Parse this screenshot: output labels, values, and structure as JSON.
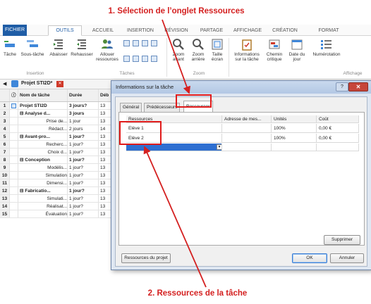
{
  "annotations": {
    "top": "1. Sélection de l’onglet Ressources",
    "bottom": "2. Ressources de la tâche"
  },
  "ribbon": {
    "tabs": [
      "FICHIER",
      "OUTILS GANTT",
      "ACCUEIL",
      "INSERTION",
      "RÉVISION",
      "PARTAGE",
      "AFFICHAGE",
      "CRÉATION",
      "FORMAT"
    ],
    "buttons": {
      "tache": "Tâche",
      "sous_tache": "Sous-tâche",
      "abaisser": "Abaisser",
      "rehausser": "Rehausser",
      "allouer": "Allouer ressources",
      "zoom_avant": "Zoom avant",
      "zoom_arriere": "Zoom arrière",
      "taille_ecran": "Taille écran",
      "informations": "Informations sur la tâche",
      "chemin_critique": "Chemin critique",
      "date_du_jour": "Date du jour",
      "numerotation": "Numérotation"
    },
    "groups": {
      "insertion": "Insertion",
      "taches": "Tâches",
      "zoom": "Zoom",
      "affichage": "Affichage"
    }
  },
  "project_tab": {
    "label": "Projet STI2D*"
  },
  "grid": {
    "headers": {
      "name": "Nom de tâche",
      "duration": "Durée",
      "start": "Déb"
    },
    "rows": [
      {
        "num": "1",
        "name": "Projet STI2D",
        "duration": "3 jours?",
        "start": "13",
        "bold": true
      },
      {
        "num": "2",
        "name": "⊟ Analyse d...",
        "duration": "3 jours",
        "start": "13",
        "bold": true
      },
      {
        "num": "3",
        "name": "Prise de...",
        "duration": "1 jour",
        "start": "13",
        "bold": false
      },
      {
        "num": "4",
        "name": "Rédact...",
        "duration": "2 jours",
        "start": "14",
        "bold": false
      },
      {
        "num": "5",
        "name": "⊟ Avant-pro...",
        "duration": "1 jour?",
        "start": "13",
        "bold": true
      },
      {
        "num": "6",
        "name": "Recherc...",
        "duration": "1 jour?",
        "start": "13",
        "bold": false
      },
      {
        "num": "7",
        "name": "Choix d...",
        "duration": "1 jour?",
        "start": "13",
        "bold": false
      },
      {
        "num": "8",
        "name": "⊟ Conception",
        "duration": "1 jour?",
        "start": "13",
        "bold": true
      },
      {
        "num": "9",
        "name": "Modélis...",
        "duration": "1 jour?",
        "start": "13",
        "bold": false
      },
      {
        "num": "10",
        "name": "Simulation",
        "duration": "1 jour?",
        "start": "13",
        "bold": false
      },
      {
        "num": "11",
        "name": "Dimensi...",
        "duration": "1 jour?",
        "start": "13",
        "bold": false
      },
      {
        "num": "12",
        "name": "⊟ Fabricatio...",
        "duration": "1 jour?",
        "start": "13",
        "bold": true
      },
      {
        "num": "13",
        "name": "Simulati...",
        "duration": "1 jour?",
        "start": "13",
        "bold": false
      },
      {
        "num": "14",
        "name": "Réalisat...",
        "duration": "1 jour?",
        "start": "13",
        "bold": false
      },
      {
        "num": "15",
        "name": "Évaluation",
        "duration": "1 jour?",
        "start": "13",
        "bold": false
      }
    ]
  },
  "dialog": {
    "title": "Informations sur la tâche",
    "help": "?",
    "close": "✕",
    "tabs": [
      "Général",
      "Prédécesseurs",
      "Ressources"
    ],
    "active_tab": "Ressources",
    "table": {
      "headers": [
        "Ressources",
        "Adresse de mes...",
        "Unités",
        "Coût"
      ],
      "rows": [
        {
          "resource": "Elève 1",
          "address": "",
          "units": "100%",
          "cost": "0,00 €"
        },
        {
          "resource": "Elève 2",
          "address": "",
          "units": "100%",
          "cost": "0,00 €"
        }
      ]
    },
    "buttons": {
      "supprimer": "Supprimer",
      "ressources_projet": "Ressources du projet",
      "ok": "OK",
      "annuler": "Annuler"
    }
  },
  "colors": {
    "annotation": "#d42020",
    "file_tab": "#1f5da6",
    "selection": "#2e6fd1"
  }
}
